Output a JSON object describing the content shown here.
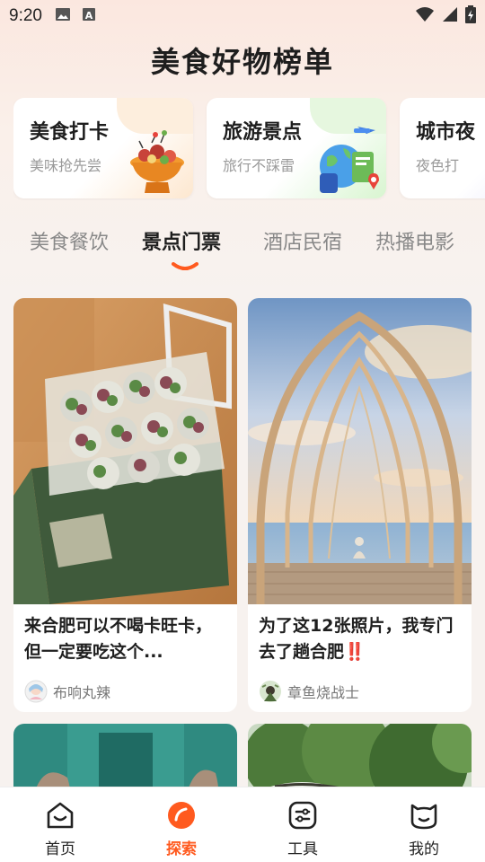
{
  "status_bar": {
    "time": "9:20",
    "icons": [
      "image-icon",
      "keyboard-a-icon",
      "wifi-icon",
      "signal-icon",
      "battery-charging-icon"
    ]
  },
  "page_title": "美食好物榜单",
  "feature_cards": [
    {
      "title": "美食打卡",
      "subtitle": "美味抢先尝",
      "icon": "food-basket-illustration"
    },
    {
      "title": "旅游景点",
      "subtitle": "旅行不踩雷",
      "icon": "globe-travel-illustration"
    },
    {
      "title": "城市夜",
      "subtitle": "夜色打"
    }
  ],
  "category_tabs": [
    {
      "label": "美食餐饮",
      "active": false
    },
    {
      "label": "景点门票",
      "active": true
    },
    {
      "label": "酒店民宿",
      "active": false
    },
    {
      "label": "热播电影",
      "active": false
    }
  ],
  "feed": [
    {
      "title": "来合肥可以不喝卡旺卡，但一定要吃这个...",
      "author": "布响丸辣"
    },
    {
      "title": "为了这12张照片，我专门去了趟合肥‼️",
      "author": "章鱼烧战士"
    },
    {
      "title": "",
      "author": ""
    },
    {
      "title": "",
      "author": ""
    }
  ],
  "bottom_nav": [
    {
      "label": "首页",
      "icon": "home-icon",
      "active": false
    },
    {
      "label": "探索",
      "icon": "explore-icon",
      "active": true
    },
    {
      "label": "工具",
      "icon": "tools-icon",
      "active": false
    },
    {
      "label": "我的",
      "icon": "profile-icon",
      "active": false
    }
  ],
  "colors": {
    "accent": "#ff5a1f",
    "background": "#f7f2ef"
  }
}
